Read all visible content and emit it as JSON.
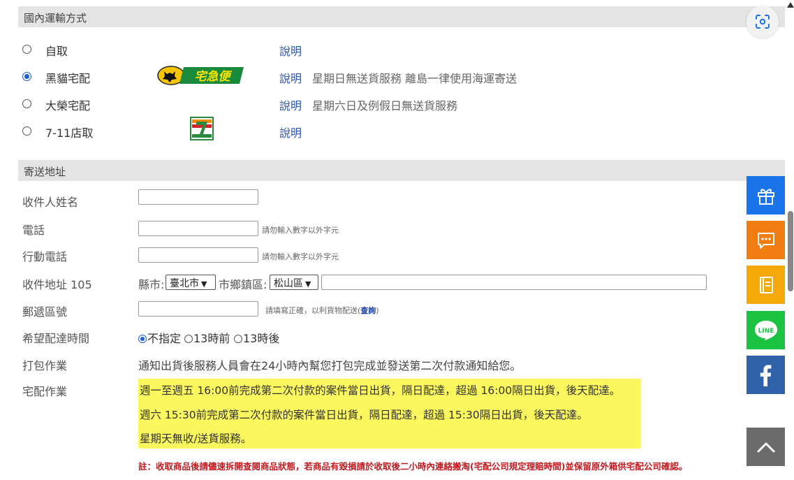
{
  "shipping": {
    "header": "國內運輸方式",
    "options": [
      {
        "label": "自取",
        "selected": false,
        "link": "說明",
        "note": ""
      },
      {
        "label": "黑貓宅配",
        "selected": true,
        "link": "說明",
        "note": "星期日無送貨服務 離島一律使用海運寄送",
        "logo": "tcat-logo"
      },
      {
        "label": "大榮宅配",
        "selected": false,
        "link": "說明",
        "note": "星期六日及例假日無送貨服務"
      },
      {
        "label": "7-11店取",
        "selected": false,
        "link": "說明",
        "note": "",
        "logo": "seven-eleven-logo"
      }
    ],
    "tcat_logo_text": "宅急便"
  },
  "address": {
    "header": "寄送地址",
    "recipient_label": "收件人姓名",
    "phone_label": "電話",
    "phone_hint": "請勿輸入數字以外字元",
    "mobile_label": "行動電話",
    "mobile_hint": "請勿輸入數字以外字元",
    "address_label": "收件地址 105",
    "city_prefix": "縣市:",
    "city_value": "臺北市",
    "district_prefix": "市鄉鎮區:",
    "district_value": "松山區",
    "zip_label": "郵遞區號",
    "zip_hint": "請填寫正確，以利貨物配送(",
    "zip_hint_link": "查詢",
    "zip_hint_end": ")",
    "time_label": "希望配達時間",
    "time_options": [
      "不指定",
      "13時前",
      "13時後"
    ],
    "packing_label": "打包作業",
    "packing_text": "通知出貨後服務人員會在24小時內幫您打包完成並發送第二次付款通知給您。",
    "delivery_label": "宅配作業",
    "delivery_lines": [
      "週一至週五 16:00前完成第二次付款的案件當日出貨，隔日配達，超過 16:00隔日出貨，後天配達。",
      "週六 15:30前完成第二次付款的案件當日出貨，隔日配達，超過 15:30隔日出貨，後天配達。",
      "星期天無收/送貨服務。"
    ],
    "footnote": "註：收取商品後請儘速拆開查閱商品狀態，若商品有毀損請於收取後二小時內連絡搬淘(宅配公司規定理賠時間)並保留原外箱供宅配公司確認。"
  },
  "sidebar": {
    "buttons": [
      "gift-icon",
      "chat-icon",
      "book-icon",
      "line-icon",
      "facebook-icon",
      "scroll-top-icon"
    ],
    "line_text": "LINE"
  },
  "colors": {
    "header_bg": "#e4e4e4",
    "link": "#2a56b8",
    "highlight": "#fbf75f",
    "footnote": "#c0191f",
    "gift": "#1a73e8",
    "chat": "#ef7d12",
    "book": "#f5a80a",
    "line": "#1cc342",
    "facebook": "#2f62a8",
    "top": "#6b6b6b"
  }
}
